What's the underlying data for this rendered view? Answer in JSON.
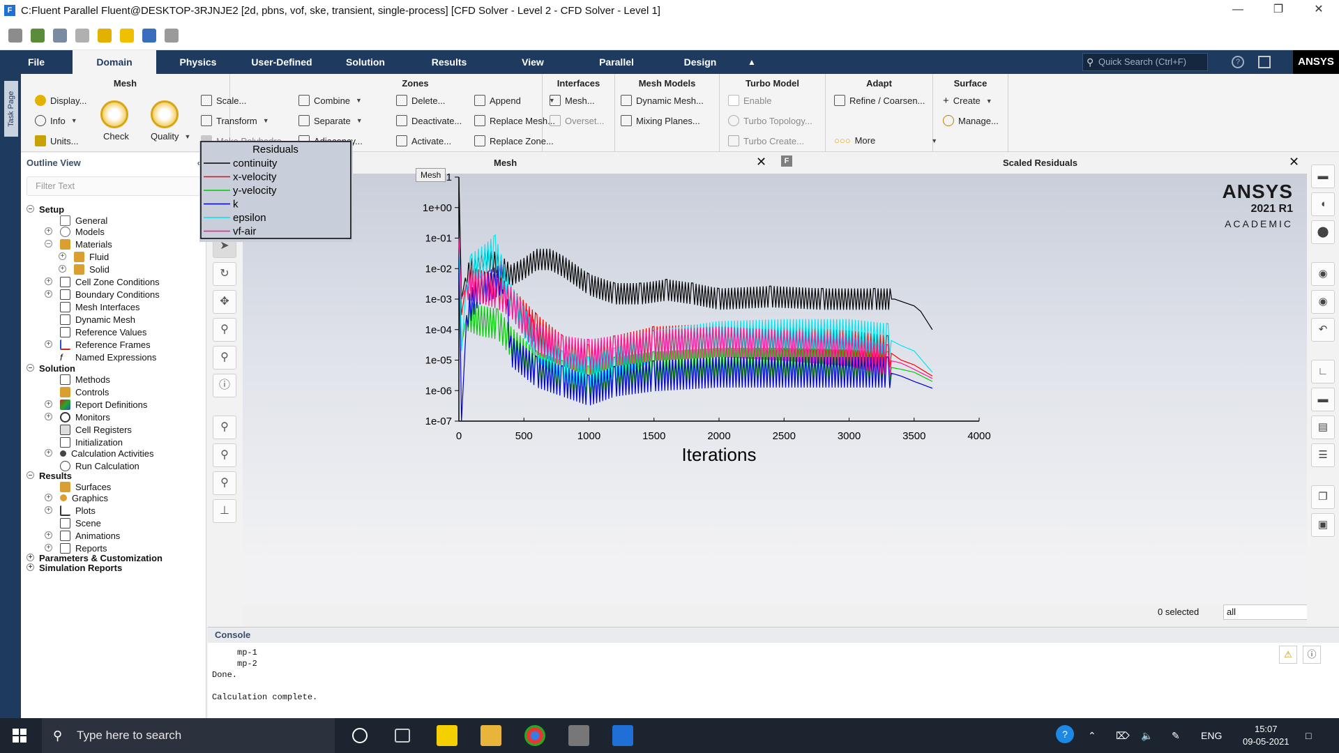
{
  "window": {
    "title": "C:Fluent Parallel Fluent@DESKTOP-3RJNJE2  [2d, pbns, vof, ske, transient, single-process] [CFD Solver - Level 2 - CFD Solver - Level 1]",
    "app_icon_letter": "F",
    "minimize": "—",
    "maximize": "❐",
    "close": "✕"
  },
  "ribbon_tabs": {
    "file": "File",
    "domain": "Domain",
    "physics": "Physics",
    "user_defined": "User-Defined",
    "solution": "Solution",
    "results": "Results",
    "view": "View",
    "parallel": "Parallel",
    "design": "Design",
    "search_placeholder": "Quick Search (Ctrl+F)",
    "brand": "ANSYS"
  },
  "ribbon": {
    "mesh": {
      "title": "Mesh",
      "display": "Display...",
      "info": "Info",
      "units": "Units...",
      "check": "Check",
      "quality": "Quality",
      "scale": "Scale...",
      "transform": "Transform",
      "make_polyhedra": "Make Polyhedra"
    },
    "zones": {
      "title": "Zones",
      "combine": "Combine",
      "separate": "Separate",
      "adjacency": "Adjacency...",
      "delete": "Delete...",
      "deactivate": "Deactivate...",
      "activate": "Activate...",
      "append": "Append",
      "replace_mesh": "Replace Mesh...",
      "replace_zone": "Replace Zone..."
    },
    "interfaces": {
      "title": "Interfaces",
      "mesh": "Mesh...",
      "overset": "Overset..."
    },
    "mesh_models": {
      "title": "Mesh Models",
      "dynamic_mesh": "Dynamic Mesh...",
      "mixing_planes": "Mixing Planes..."
    },
    "turbo_model": {
      "title": "Turbo Model",
      "enable": "Enable",
      "turbo_topology": "Turbo Topology...",
      "turbo_create": "Turbo Create..."
    },
    "adapt": {
      "title": "Adapt",
      "refine": "Refine / Coarsen...",
      "more": "More"
    },
    "surface": {
      "title": "Surface",
      "create": "Create",
      "manage": "Manage..."
    }
  },
  "task_page_label": "Task Page",
  "outline": {
    "title": "Outline View",
    "filter_placeholder": "Filter Text",
    "items": [
      {
        "label": "Setup"
      },
      {
        "label": "General"
      },
      {
        "label": "Models"
      },
      {
        "label": "Materials"
      },
      {
        "label": "Fluid"
      },
      {
        "label": "Solid"
      },
      {
        "label": "Cell Zone Conditions"
      },
      {
        "label": "Boundary Conditions"
      },
      {
        "label": "Mesh Interfaces"
      },
      {
        "label": "Dynamic Mesh"
      },
      {
        "label": "Reference Values"
      },
      {
        "label": "Reference Frames"
      },
      {
        "label": "Named Expressions"
      },
      {
        "label": "Solution"
      },
      {
        "label": "Methods"
      },
      {
        "label": "Controls"
      },
      {
        "label": "Report Definitions"
      },
      {
        "label": "Monitors"
      },
      {
        "label": "Cell Registers"
      },
      {
        "label": "Initialization"
      },
      {
        "label": "Calculation Activities"
      },
      {
        "label": "Run Calculation"
      },
      {
        "label": "Results"
      },
      {
        "label": "Surfaces"
      },
      {
        "label": "Graphics"
      },
      {
        "label": "Plots"
      },
      {
        "label": "Scene"
      },
      {
        "label": "Animations"
      },
      {
        "label": "Reports"
      },
      {
        "label": "Parameters & Customization"
      },
      {
        "label": "Simulation Reports"
      }
    ]
  },
  "graphics": {
    "tab_mesh": "Mesh",
    "tab_residuals": "Scaled Residuals",
    "tooltip": "Mesh",
    "close": "✕",
    "logo_line1": "ANSYS",
    "logo_line2": "2021 R1",
    "logo_line3": "ACADEMIC",
    "selected_count": "0 selected",
    "selection_filter": "all"
  },
  "chart_data": {
    "type": "line",
    "title": "",
    "xlabel": "Iterations",
    "ylabel": "",
    "xlim": [
      0,
      4000
    ],
    "ylim_log10": [
      -7,
      1
    ],
    "log_y": true,
    "x_ticks": [
      "0",
      "500",
      "1000",
      "1500",
      "2000",
      "2500",
      "3000",
      "3500",
      "4000"
    ],
    "y_ticks": [
      "1e-07",
      "1e-06",
      "1e-05",
      "1e-04",
      "1e-03",
      "1e-02",
      "1e-01",
      "1e+00",
      "1e+01"
    ],
    "legend_title": "Residuals",
    "legend_position": "top-left",
    "series": [
      {
        "name": "continuity",
        "color": "#000000",
        "x": [
          0,
          20,
          50,
          100,
          200,
          300,
          400,
          500,
          600,
          700,
          800,
          1000,
          1200,
          1400,
          1600,
          1800,
          2000,
          2400,
          2800,
          3200,
          3350,
          3500,
          3550,
          3640
        ],
        "y": [
          10,
          0.001,
          0.005,
          0.01,
          0.02,
          0.015,
          0.006,
          0.01,
          0.02,
          0.02,
          0.012,
          0.003,
          0.0015,
          0.0015,
          0.002,
          0.0015,
          0.001,
          0.0012,
          0.001,
          0.001,
          0.001,
          0.0006,
          0.0004,
          0.0001
        ]
      },
      {
        "name": "x-velocity",
        "color": "#ff0000",
        "x": [
          0,
          20,
          60,
          150,
          300,
          400,
          600,
          800,
          1000,
          1200,
          1500,
          2000,
          2500,
          3000,
          3300,
          3400,
          3500,
          3640
        ],
        "y": [
          0.1,
          0.0003,
          0.004,
          0.003,
          0.002,
          0.0008,
          0.0001,
          2e-05,
          1e-05,
          2e-05,
          4e-05,
          5e-05,
          4e-05,
          3e-05,
          2e-05,
          1e-05,
          7e-06,
          3e-06
        ]
      },
      {
        "name": "y-velocity",
        "color": "#00cc00",
        "x": [
          0,
          20,
          60,
          150,
          300,
          350,
          400,
          600,
          800,
          1000,
          1200,
          1500,
          2000,
          2500,
          3000,
          3300,
          3400,
          3500,
          3640
        ],
        "y": [
          0.1,
          3e-05,
          0.0003,
          0.0002,
          0.00015,
          8e-05,
          4e-05,
          6e-06,
          3e-06,
          2e-06,
          4e-06,
          6e-06,
          8e-06,
          8e-06,
          7e-06,
          6e-06,
          5e-06,
          4e-06,
          2e-06
        ]
      },
      {
        "name": "k",
        "color": "#0000cc",
        "x": [
          0,
          20,
          60,
          150,
          250,
          350,
          400,
          600,
          800,
          1000,
          1200,
          1500,
          2000,
          2500,
          3000,
          3300,
          3400,
          3500,
          3640
        ],
        "y": [
          0.1,
          1e-07,
          0.0003,
          0.002,
          0.003,
          0.005,
          2e-05,
          4e-06,
          2e-06,
          1e-06,
          2e-06,
          3e-06,
          4e-06,
          4e-06,
          4e-06,
          4e-06,
          3e-06,
          2e-06,
          1.2e-06
        ]
      },
      {
        "name": "epsilon",
        "color": "#00e5ee",
        "x": [
          0,
          20,
          60,
          100,
          200,
          280,
          300,
          400,
          600,
          800,
          1000,
          1200,
          1500,
          2000,
          2500,
          3000,
          3300,
          3400,
          3500,
          3640
        ],
        "y": [
          0.1,
          2e-05,
          0.004,
          0.01,
          0.02,
          0.04,
          0.02,
          0.001,
          3e-05,
          6e-06,
          4e-06,
          8e-06,
          3e-05,
          6e-05,
          7e-05,
          7e-05,
          5e-05,
          3e-05,
          2e-05,
          4e-06
        ]
      },
      {
        "name": "vf-air",
        "color": "#ff1493",
        "x": [
          0,
          20,
          60,
          150,
          300,
          400,
          500,
          600,
          800,
          1000,
          1200,
          1500,
          2000,
          2500,
          3000,
          3300,
          3400,
          3500,
          3640
        ],
        "y": [
          0.1,
          0.001,
          0.003,
          0.0025,
          0.0015,
          0.0008,
          0.0002,
          5e-05,
          2e-05,
          1.5e-05,
          2e-05,
          3e-05,
          4e-05,
          3e-05,
          2e-05,
          1e-05,
          8e-06,
          5e-06,
          2.5e-06
        ]
      }
    ]
  },
  "console": {
    "title": "Console",
    "lines": "     mp-1\n     mp-2\nDone.\n\nCalculation complete."
  },
  "taskbar": {
    "search_placeholder": "Type here to search",
    "lang": "ENG",
    "time": "15:07",
    "date": "09-05-2021"
  }
}
